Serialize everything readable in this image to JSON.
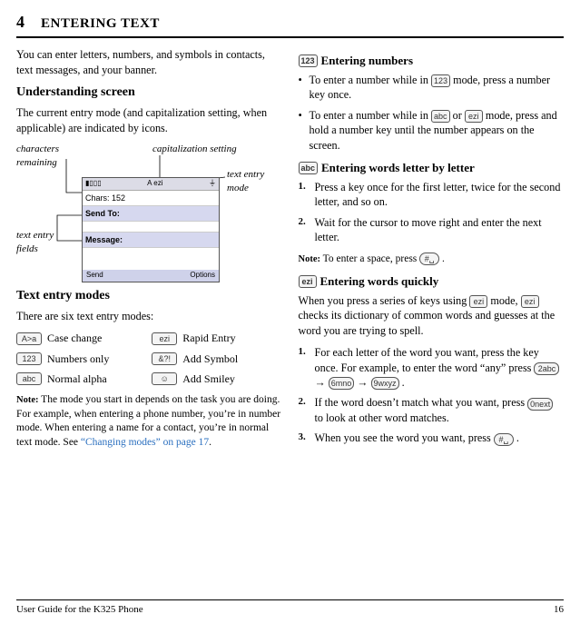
{
  "chapter": {
    "number": "4",
    "title": "ENTERING TEXT"
  },
  "left": {
    "intro": "You can enter letters, numbers, and symbols in contacts, text messages, and your banner.",
    "understanding_heading": "Understanding screen",
    "understanding_body": "The current entry mode (and capitalization setting, when applicable) are indicated by icons.",
    "diagram": {
      "chars_remaining_label": "characters remaining",
      "cap_setting_label": "capitalization setting",
      "text_entry_mode_label": "text entry mode",
      "text_entry_fields_label": "text entry fields",
      "screen": {
        "status_left": "▮▯▯▯",
        "status_mid": "A   ezi",
        "status_right": "⏚",
        "chars_line": "Chars: 152",
        "send_to": "Send To:",
        "message": "Message:",
        "soft_left": "Send",
        "soft_right": "Options"
      }
    },
    "modes_heading": "Text entry modes",
    "modes_intro": "There are six text entry modes:",
    "modes": [
      {
        "icon": "A>a",
        "label": "Case change"
      },
      {
        "icon": "ezi",
        "label": "Rapid Entry"
      },
      {
        "icon": "123",
        "label": "Numbers only"
      },
      {
        "icon": "&?!",
        "label": "Add Symbol"
      },
      {
        "icon": "abc",
        "label": "Normal alpha"
      },
      {
        "icon": "☺",
        "label": "Add Smiley"
      }
    ],
    "modes_note": "The mode you start in depends on the task you are doing. For example, when entering a phone number, you’re in number mode. When entering a name for a contact, you’re in normal text mode. See ",
    "modes_note_link": "“Changing modes” on page 17",
    "modes_note_end": "."
  },
  "right": {
    "numbers_icon": "123",
    "numbers_heading": "Entering numbers",
    "numbers_b1a": "To enter a number while in ",
    "numbers_b1_icon": "123",
    "numbers_b1b": " mode, press a number key once.",
    "numbers_b2a": "To enter a number while in ",
    "numbers_b2_icon1": "abc",
    "numbers_b2_mid": " or ",
    "numbers_b2_icon2": "ezi",
    "numbers_b2b": " mode, press and hold a number key until the number appears on the screen.",
    "letters_icon": "abc",
    "letters_heading": "Entering words letter by letter",
    "letters_s1": "Press a key once for the first letter, twice for the second letter, and so on.",
    "letters_s2": "Wait for the cursor to move right and enter the next letter.",
    "letters_note_a": "To enter a space, press ",
    "letters_note_icon": "#␣",
    "letters_note_b": " .",
    "quickly_icon": "ezi",
    "quickly_heading": "Entering words quickly",
    "quickly_intro_a": "When you press a series of keys using ",
    "quickly_intro_icon1": "ezi",
    "quickly_intro_b": " mode, ",
    "quickly_intro_icon2": "ezi",
    "quickly_intro_c": " checks its dictionary of common words and guesses at the word you are trying to spell.",
    "quickly_s1a": "For each letter of the word you want, press the key once. For example, to enter the word “any” press ",
    "quickly_s1_k1": "2abc",
    "quickly_s1_arrow1": " → ",
    "quickly_s1_k2": "6mno",
    "quickly_s1_arrow2": " → ",
    "quickly_s1_k3": "9wxyz",
    "quickly_s1b": " .",
    "quickly_s2a": "If the word doesn’t match what you want, press ",
    "quickly_s2_key": "0next",
    "quickly_s2b": " to look at other word matches.",
    "quickly_s3a": "When you see the word you want, press ",
    "quickly_s3_key": "#␣",
    "quickly_s3b": " ."
  },
  "note_label": "Note:",
  "footer": {
    "left": "User Guide for the K325 Phone",
    "right": "16"
  }
}
